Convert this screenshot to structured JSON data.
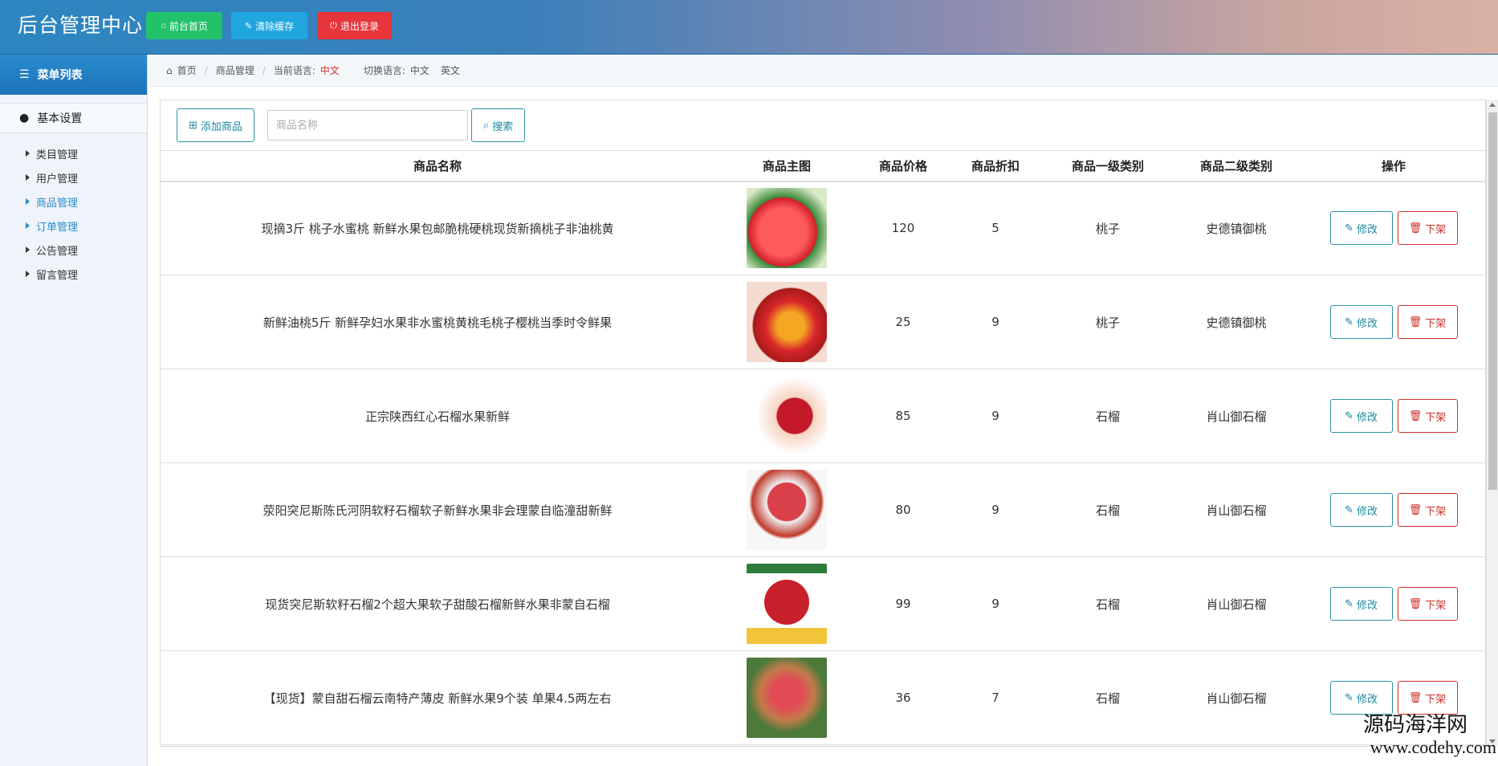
{
  "header": {
    "brand": "后台管理中心",
    "home_btn": "前台首页",
    "cache_btn": "清除缓存",
    "logout_btn": "退出登录",
    "colors": {
      "home": "#22c26b",
      "cache": "#21a6e0",
      "logout": "#e8343b"
    }
  },
  "sidebar": {
    "menu_title": "菜单列表",
    "group_title": "基本设置",
    "items": [
      {
        "label": "类目管理",
        "active": false
      },
      {
        "label": "用户管理",
        "active": false
      },
      {
        "label": "商品管理",
        "active": true
      },
      {
        "label": "订单管理",
        "active": true
      },
      {
        "label": "公告管理",
        "active": false
      },
      {
        "label": "留言管理",
        "active": false
      }
    ]
  },
  "breadcrumb": {
    "home": "首页",
    "current": "商品管理",
    "lang_label": "当前语言:",
    "lang_value": "中文",
    "switch_label": "切换语言:",
    "switch_cn": "中文",
    "switch_en": "英文"
  },
  "toolbar": {
    "add_btn": "添加商品",
    "search_placeholder": "商品名称",
    "search_btn": "搜索"
  },
  "table": {
    "headers": [
      "商品名称",
      "商品主图",
      "商品价格",
      "商品折扣",
      "商品一级类别",
      "商品二级类别",
      "操作"
    ],
    "edit_label": "修改",
    "off_label": "下架",
    "rows": [
      {
        "name": "现摘3斤 桃子水蜜桃 新鲜水果包邮脆桃硬桃现货新摘桃子非油桃黄",
        "price": "120",
        "discount": "5",
        "cat1": "桃子",
        "cat2": "史德镇御桃"
      },
      {
        "name": "新鲜油桃5斤 新鲜孕妇水果非水蜜桃黄桃毛桃子樱桃当季时令鲜果",
        "price": "25",
        "discount": "9",
        "cat1": "桃子",
        "cat2": "史德镇御桃"
      },
      {
        "name": "正宗陕西红心石榴水果新鲜",
        "price": "85",
        "discount": "9",
        "cat1": "石榴",
        "cat2": "肖山御石榴"
      },
      {
        "name": "荥阳突尼斯陈氏河阴软籽石榴软子新鲜水果非会理蒙自临潼甜新鲜",
        "price": "80",
        "discount": "9",
        "cat1": "石榴",
        "cat2": "肖山御石榴"
      },
      {
        "name": "现货突尼斯软籽石榴2个超大果软子甜酸石榴新鲜水果非蒙自石榴",
        "price": "99",
        "discount": "9",
        "cat1": "石榴",
        "cat2": "肖山御石榴"
      },
      {
        "name": "【现货】蒙自甜石榴云南特产薄皮 新鲜水果9个装 单果4.5两左右",
        "price": "36",
        "discount": "7",
        "cat1": "石榴",
        "cat2": "肖山御石榴"
      }
    ]
  },
  "watermark": {
    "cn": "源码海洋网",
    "url": "www.codehy.com"
  }
}
